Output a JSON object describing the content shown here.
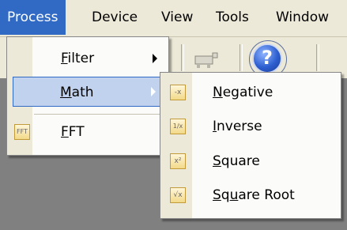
{
  "menubar": {
    "items": [
      {
        "label": "Process",
        "active": true
      },
      {
        "label": "Device"
      },
      {
        "label": "View"
      },
      {
        "label": "Tools"
      },
      {
        "label": "Window"
      }
    ]
  },
  "process_menu": {
    "items": [
      {
        "mnemonic": "F",
        "rest": "ilter",
        "has_submenu": true
      },
      {
        "mnemonic": "M",
        "rest": "ath",
        "has_submenu": true,
        "highlighted": true
      },
      {
        "mnemonic": "F",
        "rest": "FT",
        "icon": "fft-icon",
        "icon_text": "FFT"
      }
    ]
  },
  "math_submenu": {
    "items": [
      {
        "mnemonic": "N",
        "rest": "egative",
        "icon": "negative-icon",
        "icon_text": "-x"
      },
      {
        "mnemonic": "I",
        "rest": "nverse",
        "icon": "inverse-icon",
        "icon_text": "1/x"
      },
      {
        "mnemonic": "S",
        "rest": "quare",
        "icon": "square-icon",
        "icon_text": "x²"
      },
      {
        "mnemonic": "S",
        "rest": "q",
        "mnemonic2": "u",
        "rest2": "are Root",
        "icon": "square-root-icon",
        "icon_text": "√x"
      }
    ]
  },
  "toolbar": {
    "help_glyph": "?"
  },
  "colors": {
    "menubar_bg": "#ece9d8",
    "selection": "#316ac5",
    "highlight_bg": "#c1d2ee",
    "background": "#808080"
  }
}
